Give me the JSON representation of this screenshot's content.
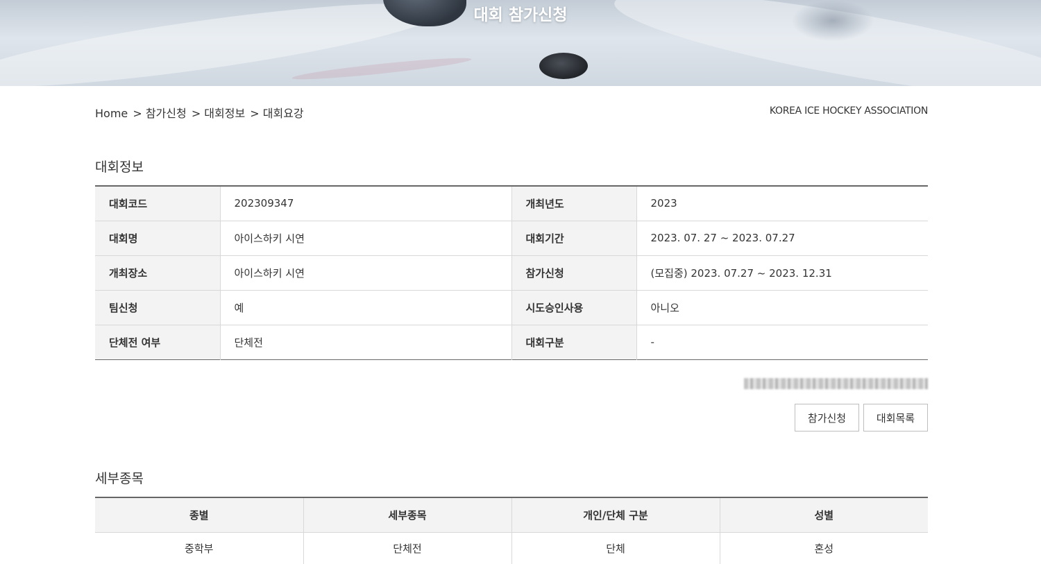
{
  "hero": {
    "title": "대회 참가신청"
  },
  "breadcrumb": [
    "Home",
    "> 참가신청",
    "> 대회정보",
    "> 대회요강"
  ],
  "org_name": "KOREA ICE HOCKEY ASSOCIATION",
  "info_section": {
    "title": "대회정보",
    "rows": [
      {
        "l_label": "대회코드",
        "l_value": "202309347",
        "r_label": "개최년도",
        "r_value": "2023"
      },
      {
        "l_label": "대회명",
        "l_value": "아이스하키 시연",
        "r_label": "대회기간",
        "r_value": "2023. 07. 27 ~ 2023. 07.27"
      },
      {
        "l_label": "개최장소",
        "l_value": "아이스하키 시연",
        "r_label": "참가신청",
        "r_value": "(모집중) 2023. 07.27 ~ 2023. 12.31"
      },
      {
        "l_label": "팀신청",
        "l_value": "예",
        "r_label": "시도승인사용",
        "r_value": "아니오"
      },
      {
        "l_label": "단체전 여부",
        "l_value": "단체전",
        "r_label": "대회구분",
        "r_value": "-"
      }
    ]
  },
  "buttons": {
    "apply": "참가신청",
    "list": "대회목록"
  },
  "detail_section": {
    "title": "세부종목",
    "headers": [
      "종별",
      "세부종목",
      "개인/단체 구분",
      "성별"
    ],
    "rows": [
      [
        "중학부",
        "단체전",
        "단체",
        "혼성"
      ]
    ]
  }
}
